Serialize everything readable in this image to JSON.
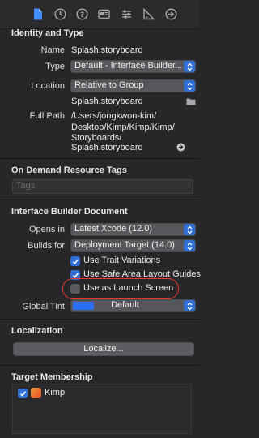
{
  "toolbar": {
    "icons": [
      "document-icon",
      "history-icon",
      "help-icon",
      "identity-card-icon",
      "sliders-icon",
      "ruler-icon",
      "arrow-right-circle-icon"
    ]
  },
  "identity": {
    "title": "Identity and Type",
    "name_label": "Name",
    "name_value": "Splash.storyboard",
    "type_label": "Type",
    "type_value": "Default - Interface Builder...",
    "location_label": "Location",
    "location_value": "Relative to Group",
    "location_file": "Splash.storyboard",
    "fullpath_label": "Full Path",
    "fullpath_lines": [
      "/Users/jongkwon-kim/",
      "Desktop/Kimp/Kimp/Kimp/",
      "Storyboards/",
      "Splash.storyboard"
    ]
  },
  "odr": {
    "title": "On Demand Resource Tags",
    "placeholder": "Tags"
  },
  "ibdoc": {
    "title": "Interface Builder Document",
    "opens_in_label": "Opens in",
    "opens_in_value": "Latest Xcode (12.0)",
    "builds_for_label": "Builds for",
    "builds_for_value": "Deployment Target (14.0)",
    "use_trait": "Use Trait Variations",
    "use_safe_area": "Use Safe Area Layout Guides",
    "use_launch": "Use as Launch Screen",
    "global_tint_label": "Global Tint",
    "global_tint_value": "Default",
    "tint_color": "#2a6ff0"
  },
  "localization": {
    "title": "Localization",
    "button": "Localize..."
  },
  "target": {
    "title": "Target Membership",
    "items": [
      {
        "name": "Kimp",
        "checked": true
      }
    ]
  },
  "colors": {
    "accent": "#2f6fd6",
    "annotation": "#e23b2e"
  }
}
